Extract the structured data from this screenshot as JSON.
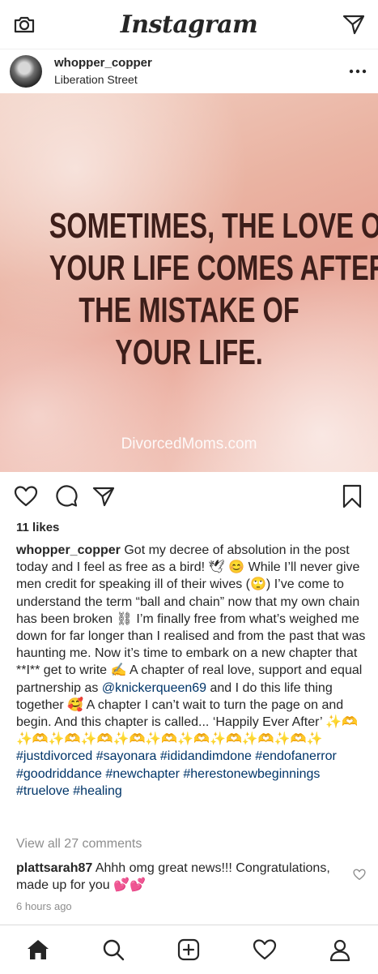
{
  "app": {
    "title": "Instagram"
  },
  "post": {
    "username": "whopper_copper",
    "location": "Liberation Street",
    "image": {
      "quote_lines": [
        "SOMETIMES, THE LOVE OF",
        "YOUR LIFE COMES AFTER",
        "THE MISTAKE OF",
        "YOUR LIFE."
      ],
      "watermark": "DivorcedMoms.com"
    },
    "likes": "11 likes",
    "caption": {
      "username": "whopper_copper",
      "text": "Got my decree of absolution in the post today and I feel as free as a bird! 🕊 😊 While I’ll never give men credit for speaking ill of their wives (🙄) I’ve come to understand the term “ball and chain” now that my own chain has been broken ⛓ I’m finally free from what’s weighed me down for far longer than I realised and from the past that was haunting me. Now it’s time to embark on a new chapter that **I** get to write ✍ A chapter of real love, support and equal partnership as",
      "mention": "@knickerqueen69",
      "text2": " and I do this life thing together 🥰 A chapter I can’t wait to turn the page on and begin. And this chapter is called... ‘Happily Ever After’ ✨🫶✨🫶✨🫶✨🫶✨🫶✨🫶✨🫶✨🫶✨🫶✨🫶✨",
      "hashtags": "#justdivorced #sayonara #ididandimdone #endofanerror #goodriddance #newchapter #herestonewbeginnings #truelove #healing"
    },
    "view_all_comments": "View all 27 comments",
    "comment": {
      "username": "plattsarah87",
      "text": "Ahhh omg great news!!! Congratulations, made up for you 💕💕"
    },
    "time": "6 hours ago"
  },
  "icons": {
    "top": [
      "camera-icon",
      "direct-message-icon"
    ],
    "header": [
      "more-options-icon"
    ],
    "actions": [
      "like-heart-icon",
      "comment-icon",
      "share-icon",
      "save-bookmark-icon"
    ],
    "bottom_nav": [
      "home-icon",
      "search-icon",
      "new-post-icon",
      "activity-heart-icon",
      "profile-icon"
    ]
  }
}
